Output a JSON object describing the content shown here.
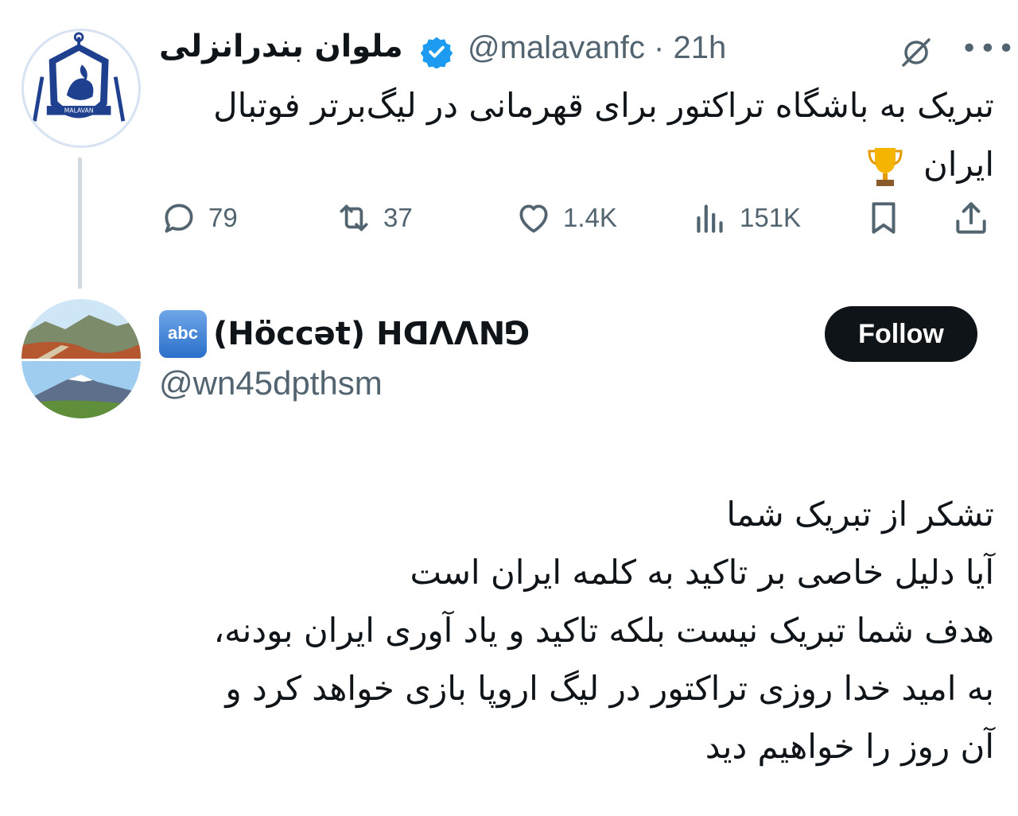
{
  "parent_tweet": {
    "author_name": "ملوان بندرانزلی",
    "handle": "@malavanfc",
    "separator": "·",
    "time": "21h",
    "avatar_text": "MALAVAN",
    "text_line1": "تبریک به باشگاه تراکتور برای قهرمانی در لیگ‌برتر فوتبال",
    "text_line2": "ایران",
    "trophy_emoji": "🏆",
    "actions": {
      "replies": "79",
      "reposts": "37",
      "likes": "1.4K",
      "views": "151K"
    },
    "icons": [
      "grok-icon",
      "more-icon",
      "reply-icon",
      "repost-icon",
      "like-icon",
      "views-icon",
      "bookmark-icon",
      "share-icon"
    ]
  },
  "reply_tweet": {
    "badge": "abc",
    "author_name": "(Höccət) ꓧꓷꓥꓥꓠꓨ",
    "handle": "@wn45dpthsm",
    "follow_label": "Follow",
    "lines": [
      "تشکر از تبریک شما",
      "آیا دلیل خاصی بر تاکید به کلمه ایران است",
      "هدف شما تبریک نیست بلکه تاکید و یاد آوری ایران بودنه،",
      "به امید خدا روزی تراکتور در لیگ اروپا بازی خواهد کرد و",
      "آن روز را خواهیم دید"
    ]
  },
  "colors": {
    "text": "#0f1419",
    "secondary": "#536471",
    "verified": "#1d9bf0",
    "follow_bg": "#0f1419"
  }
}
